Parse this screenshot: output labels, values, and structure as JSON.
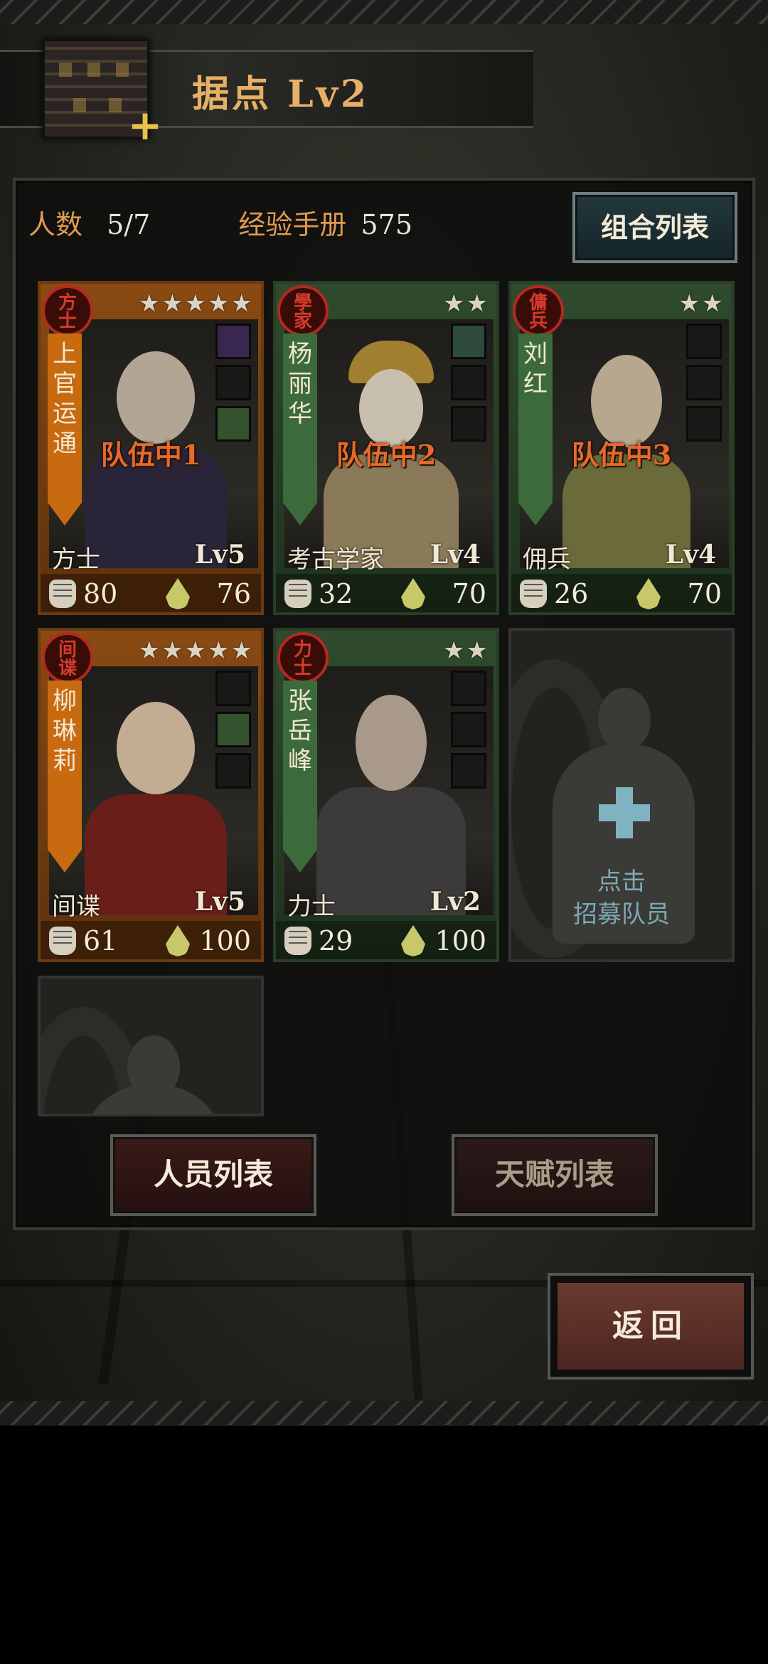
{
  "header": {
    "title": "据点 Lv2"
  },
  "stats": {
    "members_label": "人数",
    "members_value": "5/7",
    "exp_label": "经验手册",
    "exp_value": "575"
  },
  "combo_button": "组合列表",
  "cards": [
    {
      "seal": "方士",
      "name": "上官运通",
      "stars": "★★★★★",
      "team": "队伍中1",
      "class": "方士",
      "level": "Lv5",
      "strength": "80",
      "stamina": "76"
    },
    {
      "seal": "學家",
      "name": "杨丽华",
      "stars": "★★",
      "team": "队伍中2",
      "class": "考古学家",
      "level": "Lv4",
      "strength": "32",
      "stamina": "70"
    },
    {
      "seal": "傭兵",
      "name": "刘红",
      "stars": "★★",
      "team": "队伍中3",
      "class": "佣兵",
      "level": "Lv4",
      "strength": "26",
      "stamina": "70"
    },
    {
      "seal": "间谍",
      "name": "柳琳莉",
      "stars": "★★★★★",
      "team": "",
      "class": "间谍",
      "level": "Lv5",
      "strength": "61",
      "stamina": "100"
    },
    {
      "seal": "力士",
      "name": "张岳峰",
      "stars": "★★",
      "team": "",
      "class": "力士",
      "level": "Lv2",
      "strength": "29",
      "stamina": "100"
    }
  ],
  "recruit": {
    "line1": "点击",
    "line2": "招募队员"
  },
  "tabs": {
    "staff": "人员列表",
    "talent": "天赋列表"
  },
  "back_button": "返回",
  "colors": {
    "accent_orange": "#e09a52",
    "team_orange": "#e86a2a",
    "seal_red": "#b22a20",
    "recruit_blue": "#7fb3c2"
  },
  "icons": [
    "plus-icon",
    "fist-icon",
    "drop-icon",
    "star-icon",
    "cross-icon"
  ]
}
